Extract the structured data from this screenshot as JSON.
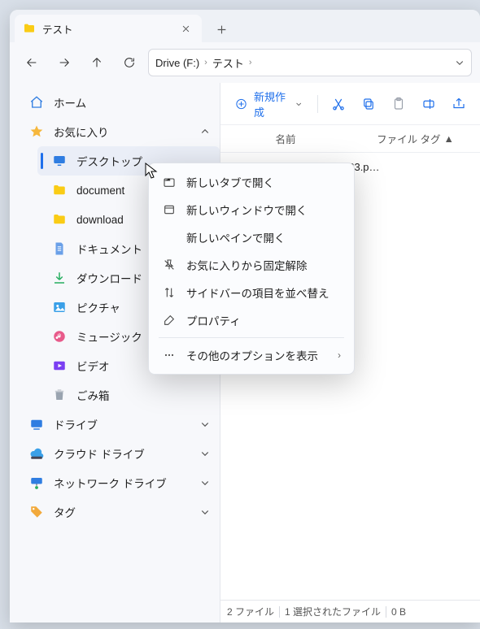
{
  "tab": {
    "title": "テスト"
  },
  "breadcrumb": {
    "segments": [
      "Drive (F:)",
      "テスト"
    ]
  },
  "sidebar": {
    "home": "ホーム",
    "favorites": "お気に入り",
    "fav_items": [
      {
        "label": "デスクトップ"
      },
      {
        "label": "document"
      },
      {
        "label": "download"
      },
      {
        "label": "ドキュメント"
      },
      {
        "label": "ダウンロード"
      },
      {
        "label": "ピクチャ"
      },
      {
        "label": "ミュージック"
      },
      {
        "label": "ビデオ"
      },
      {
        "label": "ごみ箱"
      }
    ],
    "drive": "ドライブ",
    "cloud": "クラウド ドライブ",
    "network": "ネットワーク ドライブ",
    "tags": "タグ"
  },
  "commands": {
    "new": "新規作成"
  },
  "columns": {
    "name": "名前",
    "filetag": "ファイル タグ"
  },
  "file": {
    "name": "133.p…"
  },
  "status": {
    "count": "2 ファイル",
    "selected": "1 選択されたファイル",
    "size": "0 B"
  },
  "context_menu": {
    "open_tab": "新しいタブで開く",
    "open_window": "新しいウィンドウで開く",
    "open_pane": "新しいペインで開く",
    "unpin": "お気に入りから固定解除",
    "reorder": "サイドバーの項目を並べ替え",
    "properties": "プロパティ",
    "more": "その他のオプションを表示"
  }
}
